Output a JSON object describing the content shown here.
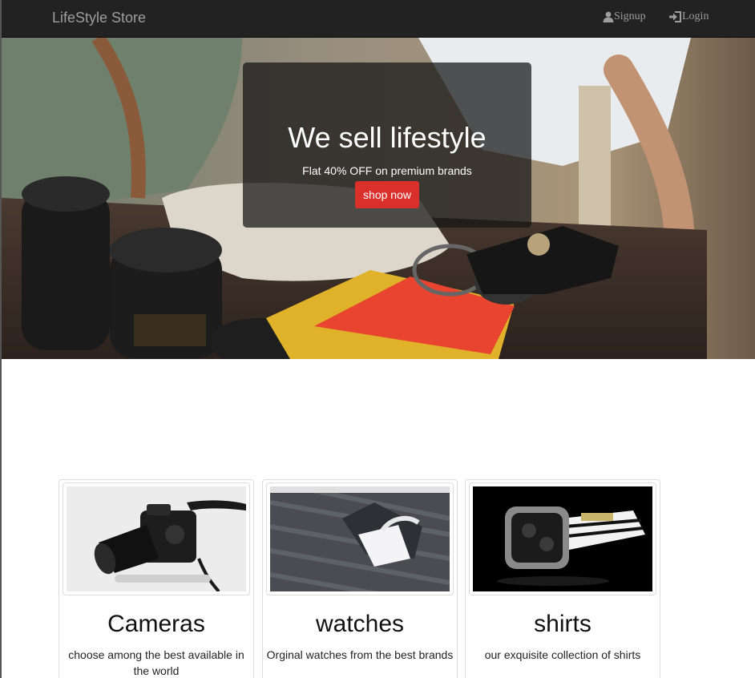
{
  "navbar": {
    "brand": "LifeStyle Store",
    "links": [
      {
        "label": "Signup",
        "icon": "user-icon"
      },
      {
        "label": "Login",
        "icon": "login-icon"
      }
    ]
  },
  "hero": {
    "title": "We sell lifestyle",
    "subtitle": "Flat 40% OFF on premium brands",
    "button_label": "shop now",
    "button_color": "#d9302c"
  },
  "cards": [
    {
      "title": "Cameras",
      "description": "choose among the best available in the world",
      "image": "camera-image"
    },
    {
      "title": "watches",
      "description": "Orginal watches from the best brands",
      "image": "shirt-image"
    },
    {
      "title": "shirts",
      "description": "our exquisite collection of shirts",
      "image": "watch-image"
    }
  ]
}
